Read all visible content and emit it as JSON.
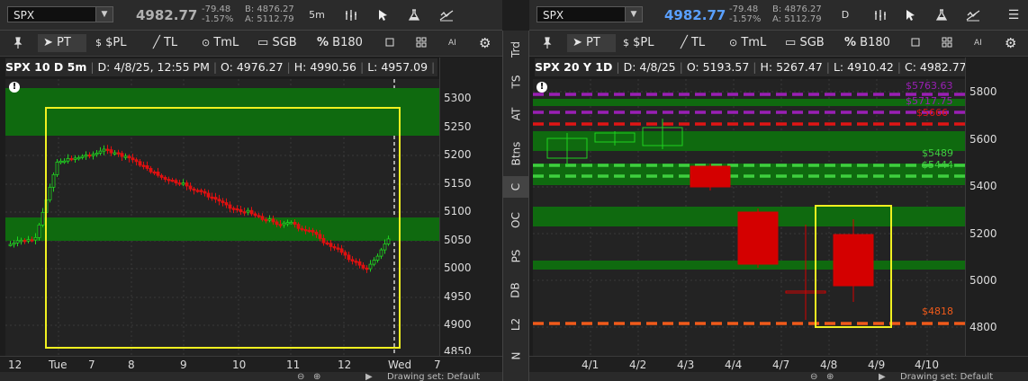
{
  "left": {
    "symbol": "SPX",
    "last": "4982.77",
    "change": "-79.48",
    "change_pct": "-1.57%",
    "bid": "B: 4876.27",
    "ask": "A: 5112.79",
    "timeframe": "5m",
    "tools": [
      "PT",
      "$PL",
      "TL",
      "TmL",
      "SGB",
      "B180"
    ],
    "info": {
      "title": "SPX 10 D 5m",
      "date": "D: 4/8/25, 12:55 PM",
      "open": "O: 4976.27",
      "high": "H: 4990.56",
      "low": "L: 4957.09",
      "more": "..."
    },
    "y_labels": [
      "5300",
      "5250",
      "5200",
      "5150",
      "5100",
      "5050",
      "5000",
      "4950",
      "4900",
      "4850"
    ],
    "x_labels": [
      "12",
      "Tue",
      "7",
      "8",
      "9",
      "10",
      "11",
      "12",
      "Wed",
      "7"
    ],
    "bottom_text": "Drawing set: Default"
  },
  "right": {
    "symbol": "SPX",
    "last": "4982.77",
    "change": "-79.48",
    "change_pct": "-1.57%",
    "bid": "B: 4876.27",
    "ask": "A: 5112.79",
    "timeframe": "D",
    "tools": [
      "PT",
      "$PL",
      "TL",
      "TmL",
      "SGB",
      "B180"
    ],
    "info": {
      "title": "SPX 20 Y 1D",
      "date": "D: 4/8/25",
      "open": "O: 5193.57",
      "high": "H: 5267.47",
      "low": "L: 4910.42",
      "close": "C: 4982.77",
      "more": "..."
    },
    "y_labels": [
      "5800",
      "5600",
      "5400",
      "5200",
      "5000",
      "4800"
    ],
    "x_labels": [
      "4/1",
      "4/2",
      "4/3",
      "4/4",
      "4/7",
      "4/8",
      "4/9",
      "4/10"
    ],
    "level_labels": [
      "$5763.63",
      "$5717.75",
      "$5666",
      "$5489",
      "$5444",
      "$4818"
    ],
    "bottom_text": "Drawing set: Default"
  },
  "side_tabs": [
    "Trd",
    "TS",
    "AT",
    "Btns",
    "C",
    "OC",
    "PS",
    "DB",
    "L2",
    "N"
  ],
  "colors": {
    "green_zone": "#0f6a0f",
    "yellow_box": "#f0f020",
    "red_candle": "#d40000",
    "down_candle": "#e01010",
    "up_candle": "#1fd21f",
    "purple_line": "#9a1fb5",
    "red_line": "#e01515",
    "green_line": "#3fcf3f",
    "orange_line": "#f05a1a",
    "price_blue": "#5aa0ff"
  }
}
